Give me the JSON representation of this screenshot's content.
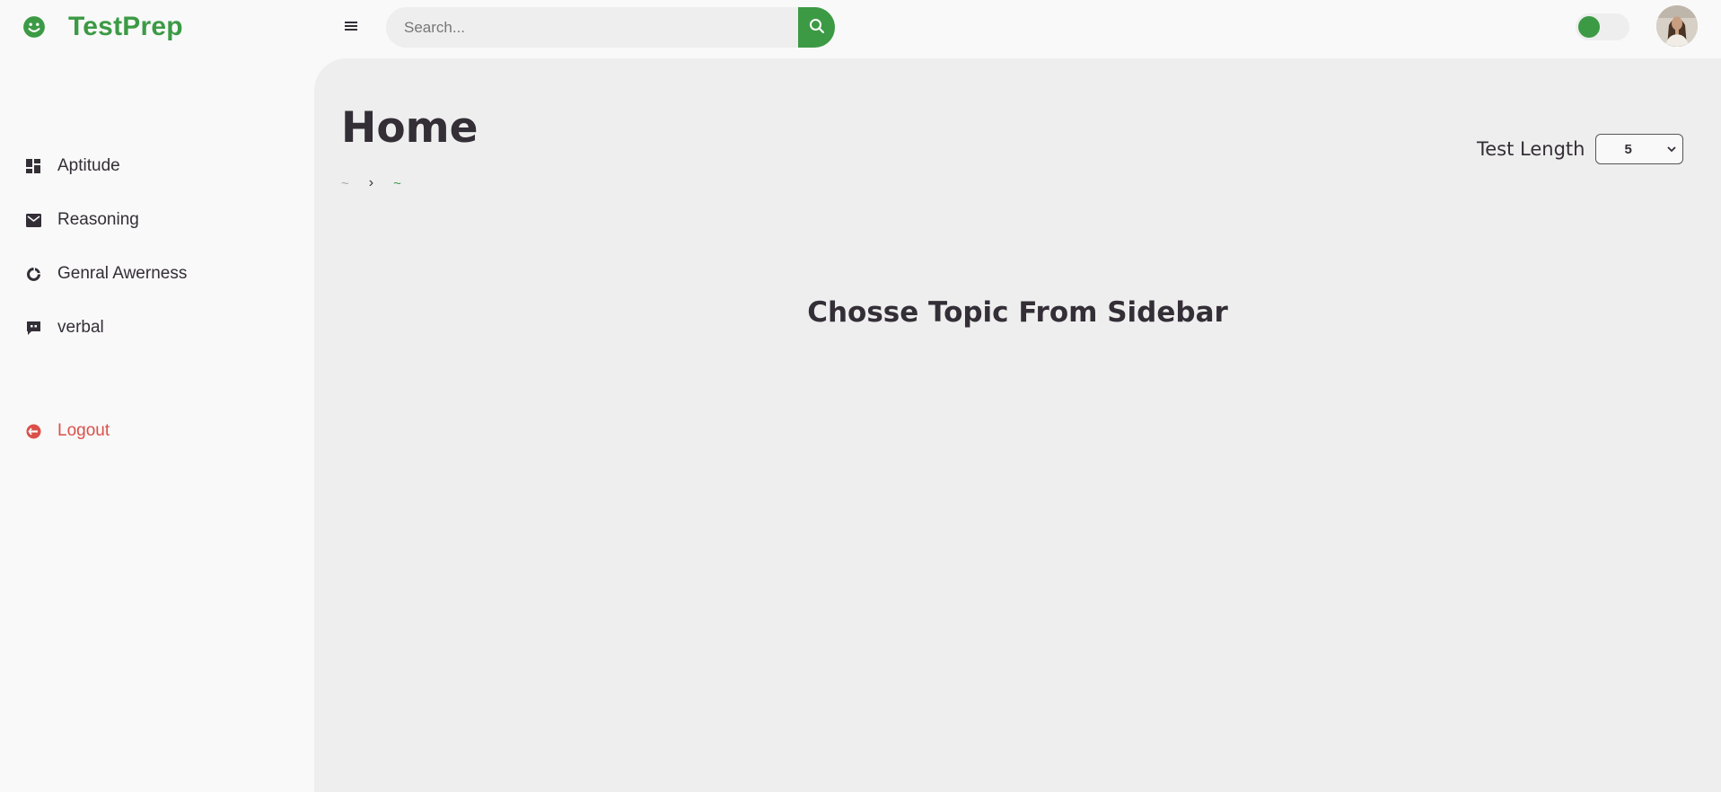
{
  "brand": {
    "name": "TestPrep",
    "icon": "smile-icon"
  },
  "sidebar": {
    "items": [
      {
        "label": "Aptitude",
        "icon": "dashboard-icon"
      },
      {
        "label": "Reasoning",
        "icon": "envelope-icon"
      },
      {
        "label": "Genral Awerness",
        "icon": "pie-chart-icon"
      },
      {
        "label": "verbal",
        "icon": "chat-bubble-icon"
      }
    ],
    "logout": {
      "label": "Logout",
      "icon": "logout-circle-icon"
    }
  },
  "topbar": {
    "menu_icon": "hamburger-menu-icon",
    "search": {
      "placeholder": "Search...",
      "value": "",
      "button_icon": "search-icon"
    },
    "theme_toggle": {
      "state": "off"
    },
    "avatar": "user-avatar"
  },
  "main": {
    "title": "Home",
    "breadcrumb": {
      "home": "~",
      "separator": "›",
      "active": "~"
    },
    "test_length": {
      "label": "Test Length",
      "selected": "5"
    },
    "message": "Chosse Topic From Sidebar"
  },
  "colors": {
    "accent": "#3c9a45",
    "danger": "#db504a",
    "text": "#342e37",
    "content_bg": "#eeeeee",
    "page_bg": "#f9f9f9"
  }
}
